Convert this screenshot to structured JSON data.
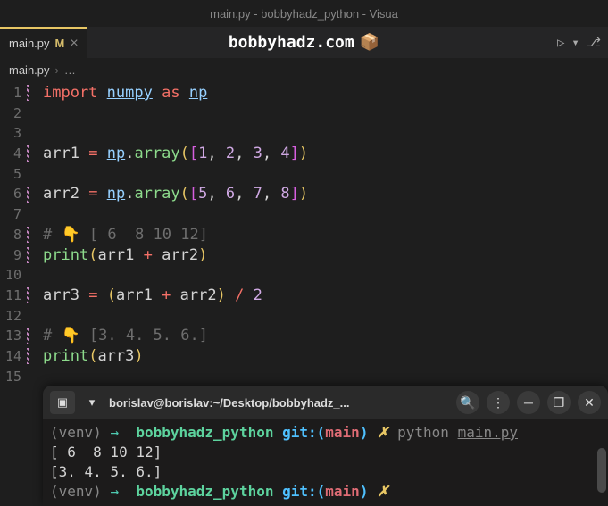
{
  "window": {
    "title": "main.py - bobbyhadz_python - Visua"
  },
  "tab": {
    "filename": "main.py",
    "modified": "M",
    "close": "×"
  },
  "watermark": {
    "text": "bobbyhadz.com",
    "cube": "📦"
  },
  "actions": {
    "run": "▷",
    "chevron": "▾",
    "branch": "⎇"
  },
  "breadcrumb": {
    "file": "main.py",
    "sep": "›",
    "more": "…"
  },
  "lines": [
    "1",
    "2",
    "3",
    "4",
    "5",
    "6",
    "7",
    "8",
    "9",
    "10",
    "11",
    "12",
    "13",
    "14",
    "15"
  ],
  "code": {
    "l1": {
      "import": "import",
      "numpy": "numpy",
      "as": "as",
      "np": "np"
    },
    "l4": {
      "arr1": "arr1",
      "eq": "=",
      "np": "np",
      "dot": ".",
      "array": "array",
      "lp": "(",
      "lb": "[",
      "n1": "1",
      "c": ",",
      "n2": "2",
      "n3": "3",
      "n4": "4",
      "rb": "]",
      "rp": ")"
    },
    "l6": {
      "arr2": "arr2",
      "eq": "=",
      "np": "np",
      "dot": ".",
      "array": "array",
      "lp": "(",
      "lb": "[",
      "n1": "5",
      "c": ",",
      "n2": "6",
      "n3": "7",
      "n4": "8",
      "rb": "]",
      "rp": ")"
    },
    "l8": {
      "hash": "#",
      "emoji": "👇",
      "rest": " [ 6  8 10 12]"
    },
    "l9": {
      "print": "print",
      "lp": "(",
      "arr1": "arr1",
      "plus": "+",
      "arr2": "arr2",
      "rp": ")"
    },
    "l11": {
      "arr3": "arr3",
      "eq": "=",
      "lp": "(",
      "arr1": "arr1",
      "plus": "+",
      "arr2": "arr2",
      "rp": ")",
      "div": "/",
      "two": "2"
    },
    "l13": {
      "hash": "#",
      "emoji": "👇",
      "rest": " [3. 4. 5. 6.]"
    },
    "l14": {
      "print": "print",
      "lp": "(",
      "arr3": "arr3",
      "rp": ")"
    }
  },
  "terminal": {
    "newTab": "▾",
    "title": "borislav@borislav:~/Desktop/bobbyhadz_...",
    "search": "🔍",
    "menu": "⋮",
    "min": "─",
    "max": "❐",
    "close": "✕",
    "lines": {
      "l1": {
        "venv": "(venv)",
        "arrow": "→",
        "path": "bobbyhadz_python",
        "git": "git:(",
        "branch": "main",
        "gitc": ")",
        "x": "✗",
        "cmd": "python",
        "file": "main.py"
      },
      "l2": "[ 6  8 10 12]",
      "l3": "[3. 4. 5. 6.]",
      "l4": {
        "venv": "(venv)",
        "arrow": "→",
        "path": "bobbyhadz_python",
        "git": "git:(",
        "branch": "main",
        "gitc": ")",
        "x": "✗"
      }
    }
  }
}
